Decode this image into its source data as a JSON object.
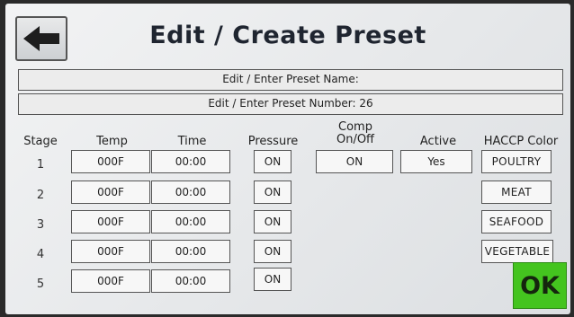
{
  "header": {
    "title": "Edit / Create Preset",
    "back_icon": "left-arrow-icon"
  },
  "form": {
    "name_label": "Edit / Enter Preset Name:",
    "number_label": "Edit / Enter Preset Number: 26"
  },
  "columns": {
    "stage": "Stage",
    "temp": "Temp",
    "time": "Time",
    "pressure": "Pressure",
    "comp": "Comp\nOn/Off",
    "active": "Active",
    "haccp": "HACCP Color"
  },
  "stages": [
    {
      "stage": "1",
      "temp": "000F",
      "time": "00:00",
      "pressure": "ON"
    },
    {
      "stage": "2",
      "temp": "000F",
      "time": "00:00",
      "pressure": "ON"
    },
    {
      "stage": "3",
      "temp": "000F",
      "time": "00:00",
      "pressure": "ON"
    },
    {
      "stage": "4",
      "temp": "000F",
      "time": "00:00",
      "pressure": "ON"
    },
    {
      "stage": "5",
      "temp": "000F",
      "time": "00:00",
      "pressure": "ON"
    }
  ],
  "comp": "ON",
  "active": "Yes",
  "haccp_colors": [
    "POULTRY",
    "MEAT",
    "SEAFOOD",
    "VEGETABLE"
  ],
  "ok_label": "OK",
  "colors": {
    "ok_green": "#44c41f",
    "background": "#eceeef"
  }
}
